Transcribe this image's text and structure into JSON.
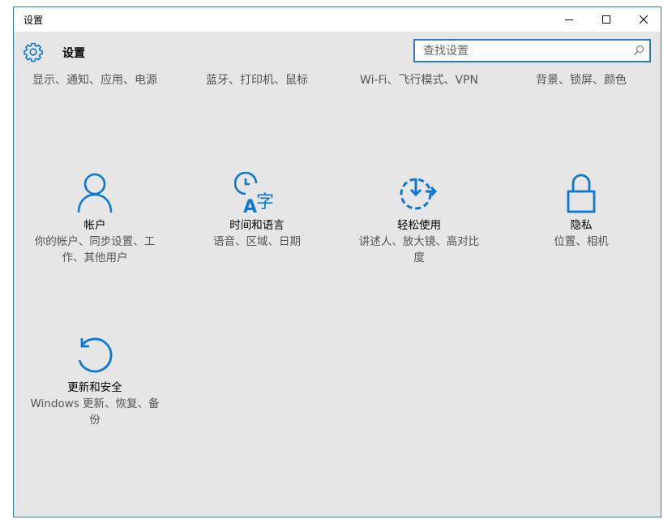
{
  "window": {
    "title": "设置"
  },
  "header": {
    "title": "设置",
    "icon": "gear-icon"
  },
  "search": {
    "placeholder": "查找设置",
    "value": ""
  },
  "accent_color": "#0a78d4",
  "partial_row": [
    {
      "desc": "显示、通知、应用、电源"
    },
    {
      "desc": "蓝牙、打印机、鼠标"
    },
    {
      "desc": "Wi-Fi、飞行模式、VPN"
    },
    {
      "desc": "背景、锁屏、颜色"
    }
  ],
  "tiles": [
    {
      "name": "帐户",
      "desc": "你的帐户、同步设置、工作、其他用户",
      "icon": "person-icon"
    },
    {
      "name": "时间和语言",
      "desc": "语音、区域、日期",
      "icon": "time-language-icon"
    },
    {
      "name": "轻松使用",
      "desc": "讲述人、放大镜、高对比度",
      "icon": "ease-of-access-icon"
    },
    {
      "name": "隐私",
      "desc": "位置、相机",
      "icon": "lock-icon"
    },
    {
      "name": "更新和安全",
      "desc": "Windows 更新、恢复、备份",
      "icon": "update-icon"
    }
  ]
}
